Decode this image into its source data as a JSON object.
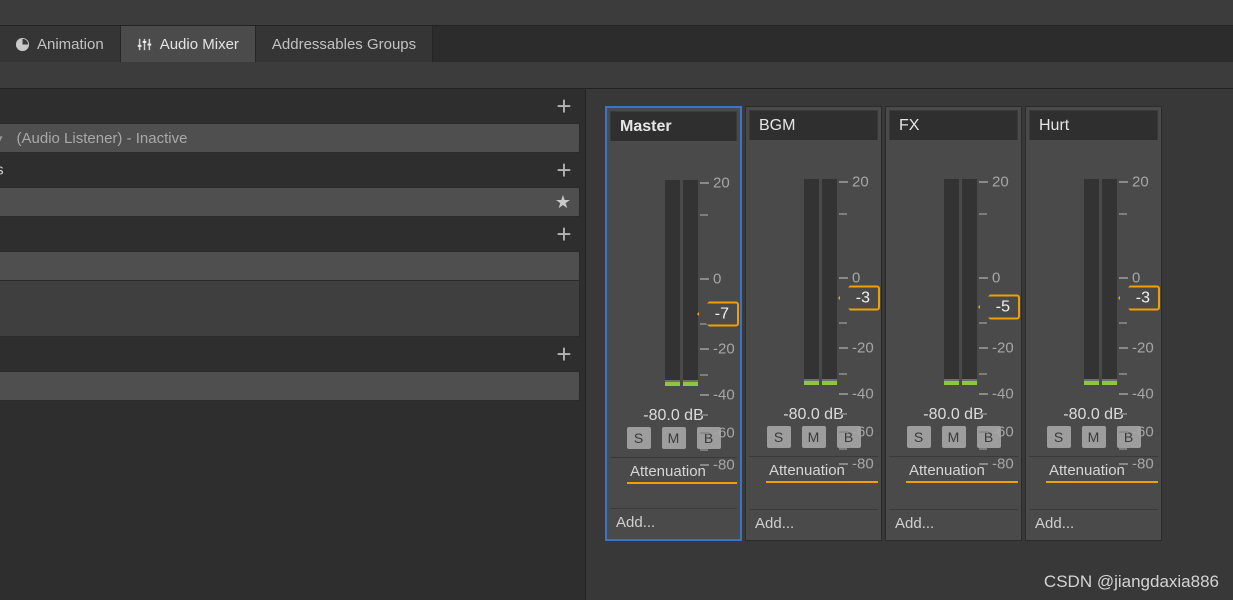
{
  "tabs": [
    {
      "label": "Animation",
      "icon": "clock-icon",
      "active": false
    },
    {
      "label": "Audio Mixer",
      "icon": "mixer-sliders-icon",
      "active": true
    },
    {
      "label": "Addressables Groups",
      "icon": "",
      "active": false
    }
  ],
  "left_panel": {
    "sections": [
      {
        "type": "header",
        "label": "",
        "plus": "+"
      },
      {
        "type": "row",
        "arrow": "▾",
        "text": "(Audio Listener) - Inactive"
      },
      {
        "type": "header",
        "label": "ts",
        "plus": "+"
      },
      {
        "type": "row_star",
        "text": "",
        "star": "★"
      },
      {
        "type": "header",
        "label": "",
        "plus": "+"
      },
      {
        "type": "row_block",
        "text": ""
      },
      {
        "type": "header",
        "label": "",
        "plus": "+"
      },
      {
        "type": "row",
        "arrow": "",
        "text": ""
      }
    ]
  },
  "mixer": {
    "scale_labels": [
      "20",
      "0",
      "-20",
      "-40",
      "-60",
      "-80"
    ],
    "db_readout": "-80.0 dB",
    "smb_buttons": [
      "S",
      "M",
      "B"
    ],
    "effect_label": "Attenuation",
    "add_label": "Add...",
    "accent_orange": "#f0a000",
    "selection_blue": "#3a74c8",
    "meter_green": "#8dc63f",
    "strips": [
      {
        "name": "Master",
        "fader_value": "-7",
        "selected": true
      },
      {
        "name": "BGM",
        "fader_value": "-3",
        "selected": false
      },
      {
        "name": "FX",
        "fader_value": "-5",
        "selected": false
      },
      {
        "name": "Hurt",
        "fader_value": "-3",
        "selected": false
      }
    ]
  },
  "watermark": "CSDN @jiangdaxia886"
}
